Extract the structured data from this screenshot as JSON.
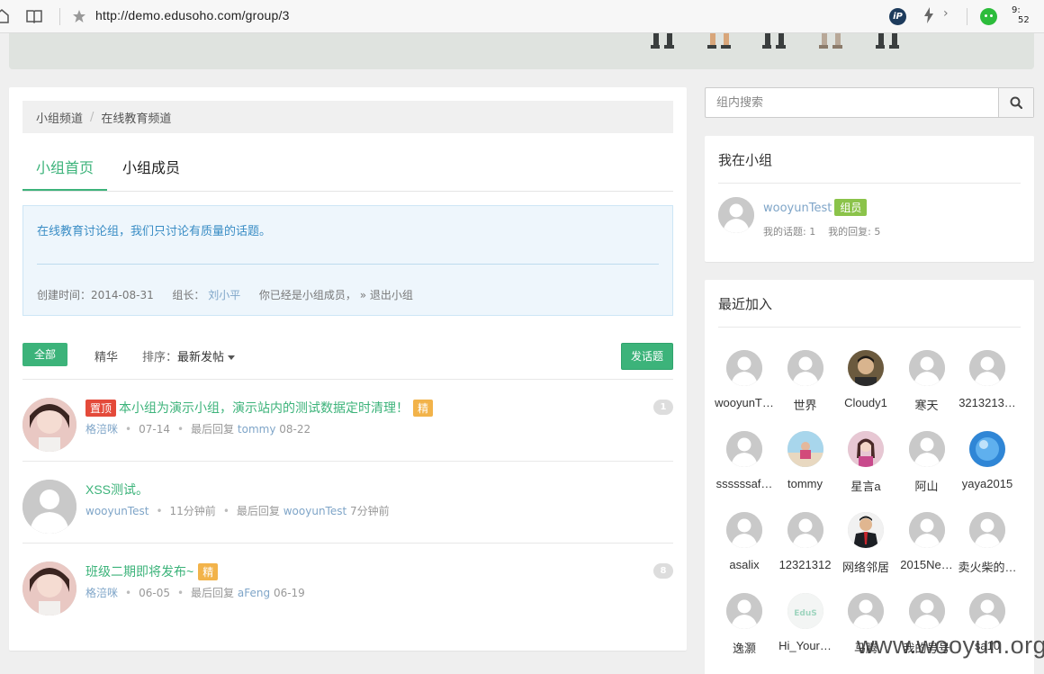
{
  "browser": {
    "url": "http://demo.edusoho.com/group/3",
    "time_hour": "9:",
    "time_min": "52"
  },
  "breadcrumb": {
    "items": [
      "小组频道",
      "在线教育频道"
    ],
    "separator": "/"
  },
  "tabs": [
    "小组首页",
    "小组成员"
  ],
  "intro": {
    "description": "在线教育讨论组，我们只讨论有质量的话题。",
    "created_label": "创建时间：2014-08-31",
    "leader_label": "组长：",
    "leader_name": "刘小平",
    "member_status": "你已经是小组成员，",
    "quit_link": "» 退出小组"
  },
  "toolbar": {
    "all_label": "全部",
    "featured_label": "精华",
    "sort_label": "排序：",
    "sort_value": "最新发帖",
    "post_label": "发话题"
  },
  "threads": [
    {
      "sticky": "置顶",
      "title": "本小组为演示小组，演示站内的测试数据定时清理！",
      "featured": "精",
      "author": "格涪咪",
      "date": "07-14",
      "last_reply_label": "最后回复",
      "last_reply_user": "tommy",
      "last_reply_date": "08-22",
      "count": "1"
    },
    {
      "sticky": "",
      "title": "XSS测试。",
      "featured": "",
      "author": "wooyunTest",
      "date": "11分钟前",
      "last_reply_label": "最后回复",
      "last_reply_user": "wooyunTest",
      "last_reply_date": "7分钟前",
      "count": ""
    },
    {
      "sticky": "",
      "title": "班级二期即将发布~",
      "featured": "精",
      "author": "格涪咪",
      "date": "06-05",
      "last_reply_label": "最后回复",
      "last_reply_user": "aFeng",
      "last_reply_date": "06-19",
      "count": "8"
    }
  ],
  "search": {
    "placeholder": "组内搜索"
  },
  "me_panel": {
    "title": "我在小组",
    "name": "wooyunTest",
    "badge": "组员",
    "stats": "我的话题: 1    我的回复: 5"
  },
  "recent_panel": {
    "title": "最近加入",
    "members": [
      {
        "name": "wooyunT…",
        "avatar": "default"
      },
      {
        "name": "世界",
        "avatar": "default"
      },
      {
        "name": "Cloudy1",
        "avatar": "photo-man"
      },
      {
        "name": "寒天",
        "avatar": "default"
      },
      {
        "name": "3213213…",
        "avatar": "default"
      },
      {
        "name": "ssssssaf…",
        "avatar": "default"
      },
      {
        "name": "tommy",
        "avatar": "photo-beach"
      },
      {
        "name": "星言a",
        "avatar": "photo-girl"
      },
      {
        "name": "阿山",
        "avatar": "default"
      },
      {
        "name": "yaya2015",
        "avatar": "photo-blue"
      },
      {
        "name": "asalix",
        "avatar": "default"
      },
      {
        "name": "12321312",
        "avatar": "default"
      },
      {
        "name": "网络邻居",
        "avatar": "photo-suit"
      },
      {
        "name": "2015Ne…",
        "avatar": "default"
      },
      {
        "name": "卖火柴的…",
        "avatar": "default"
      },
      {
        "name": "逸灏",
        "avatar": "default"
      },
      {
        "name": "Hi_Your…",
        "avatar": "logo-edusoho"
      },
      {
        "name": "马腾",
        "avatar": "default"
      },
      {
        "name": "我的号号",
        "avatar": "default"
      },
      {
        "name": "sa10",
        "avatar": "default"
      }
    ]
  },
  "watermark": "www.wooyun.org",
  "colors": {
    "accent": "#3cb37a",
    "link": "#7fa5c8",
    "sticky": "#e44a3a",
    "featured": "#f2b34a",
    "member_badge": "#8bc34a"
  }
}
